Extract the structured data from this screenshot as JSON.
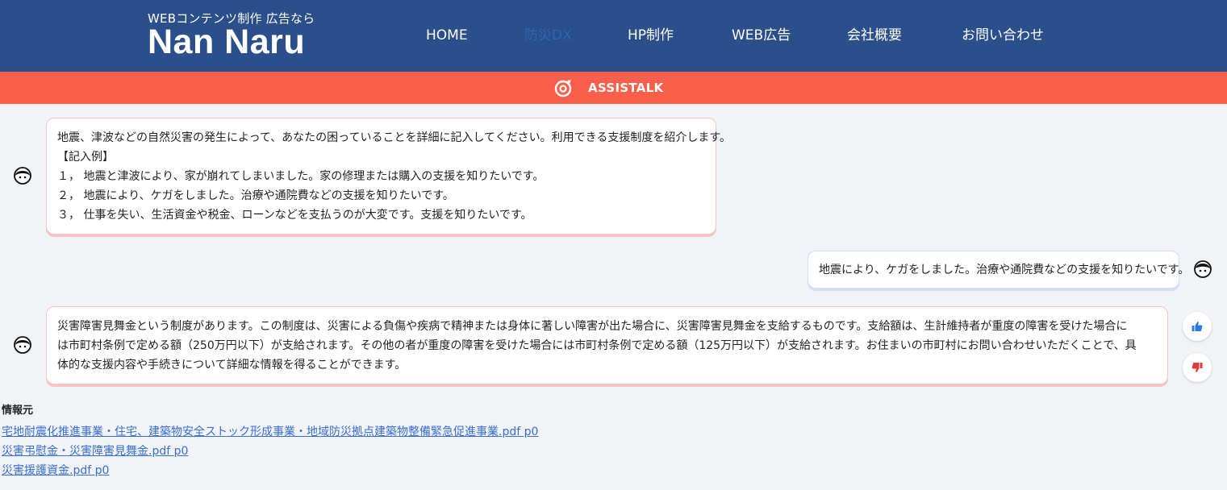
{
  "header": {
    "tagline": "WEBコンテンツ制作 広告なら",
    "brand": "Nan Naru",
    "nav": [
      {
        "label": "HOME"
      },
      {
        "label": "防災DX"
      },
      {
        "label": "HP制作"
      },
      {
        "label": "WEB広告"
      },
      {
        "label": "会社概要"
      },
      {
        "label": "お問い合わせ"
      }
    ],
    "active_nav": "防災DX"
  },
  "banner": {
    "title": "ASSISTALK",
    "icon": "assistalk-logo-icon",
    "color": "#f95f4a"
  },
  "chat": {
    "messages": [
      {
        "role": "bot",
        "lines": [
          "地震、津波などの自然災害の発生によって、あなたの困っていることを詳細に記入してください。利用できる支援制度を紹介します。",
          "【記入例】",
          "１， 地震と津波により、家が崩れてしまいました。家の修理または購入の支援を知りたいです。",
          "２， 地震により、ケガをしました。治療や通院費などの支援を知りたいです。",
          "３， 仕事を失い、生活資金や税金、ローンなどを支払うのが大変です。支援を知りたいです。"
        ]
      },
      {
        "role": "user",
        "lines": [
          "地震により、ケガをしました。治療や通院費などの支援を知りたいです。"
        ]
      },
      {
        "role": "bot",
        "lines": [
          "災害障害見舞金という制度があります。この制度は、災害による負傷や疾病で精神または身体に著しい障害が出た場合に、災害障害見舞金を支給するものです。支給額は、生計維持者が重度の障害を受けた場合に",
          "は市町村条例で定める額（250万円以下）が支給されます。その他の者が重度の障害を受けた場合には市町村条例で定める額（125万円以下）が支給されます。お住まいの市町村にお問い合わせいただくことで、具",
          "体的な支援内容や手続きについて詳細な情報を得ることができます。"
        ]
      }
    ],
    "feedback": {
      "like_icon": "thumbs-up-icon",
      "dislike_icon": "thumbs-down-icon",
      "like_color": "#2e7be0",
      "dislike_color": "#e03a3a"
    }
  },
  "sources": {
    "title": "情報元",
    "links": [
      "宅地耐震化推進事業・住宅、建築物安全ストック形成事業・地域防災拠点建築物整備緊急促進事業.pdf p0",
      "災害弔慰金・災害障害見舞金.pdf p0",
      "災害援護資金.pdf p0"
    ]
  }
}
